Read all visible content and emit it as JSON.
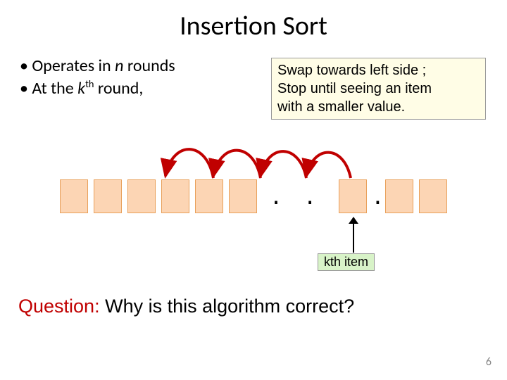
{
  "title": "Insertion Sort",
  "bullets": {
    "b1_pre": "Operates in ",
    "b1_ital": "n",
    "b1_post": " rounds",
    "b2_pre": "At the ",
    "b2_ital": "k",
    "b2_sup": "th",
    "b2_post": " round,"
  },
  "note": {
    "line1": "Swap towards left side ;",
    "line2": "Stop until seeing an item",
    "line3": "with a smaller value."
  },
  "dots": ". . . . .",
  "kth_label": "kth item",
  "question": {
    "label": "Question:",
    "text": "  Why is this algorithm correct?"
  },
  "page_number": "6",
  "colors": {
    "box_fill": "#fcd5b4",
    "note_bg": "#fffde6",
    "kth_bg": "#d8f3c8",
    "arc": "#c00000",
    "question_red": "#c00000"
  }
}
